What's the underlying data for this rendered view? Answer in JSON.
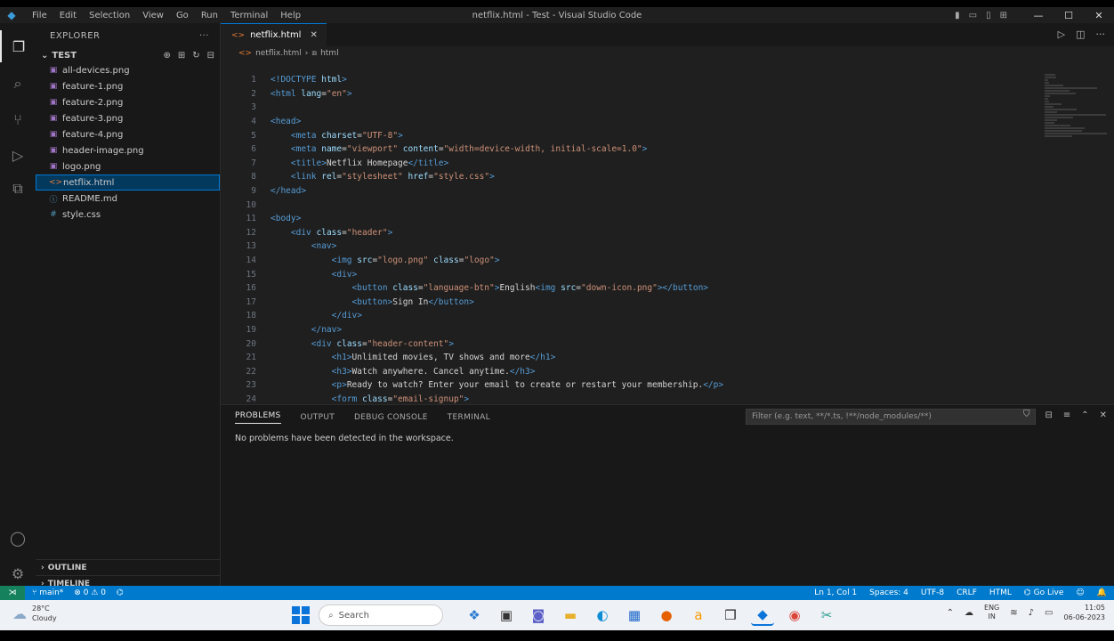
{
  "window": {
    "title": "netflix.html - Test - Visual Studio Code",
    "menu": [
      "File",
      "Edit",
      "Selection",
      "View",
      "Go",
      "Run",
      "Terminal",
      "Help"
    ]
  },
  "sidebar": {
    "header": "EXPLORER",
    "folder": "TEST",
    "files": [
      {
        "name": "all-devices.png",
        "icon": "image-icon"
      },
      {
        "name": "feature-1.png",
        "icon": "image-icon"
      },
      {
        "name": "feature-2.png",
        "icon": "image-icon"
      },
      {
        "name": "feature-3.png",
        "icon": "image-icon"
      },
      {
        "name": "feature-4.png",
        "icon": "image-icon"
      },
      {
        "name": "header-image.png",
        "icon": "image-icon"
      },
      {
        "name": "logo.png",
        "icon": "image-icon"
      },
      {
        "name": "netflix.html",
        "icon": "html-icon",
        "selected": true
      },
      {
        "name": "README.md",
        "icon": "markdown-icon"
      },
      {
        "name": "style.css",
        "icon": "css-icon"
      }
    ],
    "outline": "OUTLINE",
    "timeline": "TIMELINE"
  },
  "editor": {
    "tab": "netflix.html",
    "breadcrumb": [
      "netflix.html",
      "html"
    ],
    "lines": [
      [
        {
          "c": "t",
          "v": "<!"
        },
        {
          "c": "t",
          "v": "DOCTYPE"
        },
        {
          "c": "x",
          "v": " "
        },
        {
          "c": "a",
          "v": "html"
        },
        {
          "c": "t",
          "v": ">"
        }
      ],
      [
        {
          "c": "t",
          "v": "<html"
        },
        {
          "c": "x",
          "v": " "
        },
        {
          "c": "a",
          "v": "lang"
        },
        {
          "c": "x",
          "v": "="
        },
        {
          "c": "s",
          "v": "\"en\""
        },
        {
          "c": "t",
          "v": ">"
        }
      ],
      [],
      [
        {
          "c": "t",
          "v": "<head>"
        }
      ],
      [
        {
          "c": "x",
          "v": "    "
        },
        {
          "c": "t",
          "v": "<meta"
        },
        {
          "c": "x",
          "v": " "
        },
        {
          "c": "a",
          "v": "charset"
        },
        {
          "c": "x",
          "v": "="
        },
        {
          "c": "s",
          "v": "\"UTF-8\""
        },
        {
          "c": "t",
          "v": ">"
        }
      ],
      [
        {
          "c": "x",
          "v": "    "
        },
        {
          "c": "t",
          "v": "<meta"
        },
        {
          "c": "x",
          "v": " "
        },
        {
          "c": "a",
          "v": "name"
        },
        {
          "c": "x",
          "v": "="
        },
        {
          "c": "s",
          "v": "\"viewport\""
        },
        {
          "c": "x",
          "v": " "
        },
        {
          "c": "a",
          "v": "content"
        },
        {
          "c": "x",
          "v": "="
        },
        {
          "c": "s",
          "v": "\"width=device-width, initial-scale=1.0\""
        },
        {
          "c": "t",
          "v": ">"
        }
      ],
      [
        {
          "c": "x",
          "v": "    "
        },
        {
          "c": "t",
          "v": "<title>"
        },
        {
          "c": "x",
          "v": "Netflix Homepage"
        },
        {
          "c": "t",
          "v": "</title>"
        }
      ],
      [
        {
          "c": "x",
          "v": "    "
        },
        {
          "c": "t",
          "v": "<link"
        },
        {
          "c": "x",
          "v": " "
        },
        {
          "c": "a",
          "v": "rel"
        },
        {
          "c": "x",
          "v": "="
        },
        {
          "c": "s",
          "v": "\"stylesheet\""
        },
        {
          "c": "x",
          "v": " "
        },
        {
          "c": "a",
          "v": "href"
        },
        {
          "c": "x",
          "v": "="
        },
        {
          "c": "s",
          "v": "\"style.css\""
        },
        {
          "c": "t",
          "v": ">"
        }
      ],
      [
        {
          "c": "t",
          "v": "</head>"
        }
      ],
      [],
      [
        {
          "c": "t",
          "v": "<body>"
        }
      ],
      [
        {
          "c": "x",
          "v": "    "
        },
        {
          "c": "t",
          "v": "<div"
        },
        {
          "c": "x",
          "v": " "
        },
        {
          "c": "a",
          "v": "class"
        },
        {
          "c": "x",
          "v": "="
        },
        {
          "c": "s",
          "v": "\"header\""
        },
        {
          "c": "t",
          "v": ">"
        }
      ],
      [
        {
          "c": "x",
          "v": "        "
        },
        {
          "c": "t",
          "v": "<nav>"
        }
      ],
      [
        {
          "c": "x",
          "v": "            "
        },
        {
          "c": "t",
          "v": "<img"
        },
        {
          "c": "x",
          "v": " "
        },
        {
          "c": "a",
          "v": "src"
        },
        {
          "c": "x",
          "v": "="
        },
        {
          "c": "s",
          "v": "\"logo.png\""
        },
        {
          "c": "x",
          "v": " "
        },
        {
          "c": "a",
          "v": "class"
        },
        {
          "c": "x",
          "v": "="
        },
        {
          "c": "s",
          "v": "\"logo\""
        },
        {
          "c": "t",
          "v": ">"
        }
      ],
      [
        {
          "c": "x",
          "v": "            "
        },
        {
          "c": "t",
          "v": "<div>"
        }
      ],
      [
        {
          "c": "x",
          "v": "                "
        },
        {
          "c": "t",
          "v": "<button"
        },
        {
          "c": "x",
          "v": " "
        },
        {
          "c": "a",
          "v": "class"
        },
        {
          "c": "x",
          "v": "="
        },
        {
          "c": "s",
          "v": "\"language-btn\""
        },
        {
          "c": "t",
          "v": ">"
        },
        {
          "c": "x",
          "v": "English"
        },
        {
          "c": "t",
          "v": "<img"
        },
        {
          "c": "x",
          "v": " "
        },
        {
          "c": "a",
          "v": "src"
        },
        {
          "c": "x",
          "v": "="
        },
        {
          "c": "s",
          "v": "\"down-icon.png\""
        },
        {
          "c": "t",
          "v": "></button>"
        }
      ],
      [
        {
          "c": "x",
          "v": "                "
        },
        {
          "c": "t",
          "v": "<button>"
        },
        {
          "c": "x",
          "v": "Sign In"
        },
        {
          "c": "t",
          "v": "</button>"
        }
      ],
      [
        {
          "c": "x",
          "v": "            "
        },
        {
          "c": "t",
          "v": "</div>"
        }
      ],
      [
        {
          "c": "x",
          "v": "        "
        },
        {
          "c": "t",
          "v": "</nav>"
        }
      ],
      [
        {
          "c": "x",
          "v": "        "
        },
        {
          "c": "t",
          "v": "<div"
        },
        {
          "c": "x",
          "v": " "
        },
        {
          "c": "a",
          "v": "class"
        },
        {
          "c": "x",
          "v": "="
        },
        {
          "c": "s",
          "v": "\"header-content\""
        },
        {
          "c": "t",
          "v": ">"
        }
      ],
      [
        {
          "c": "x",
          "v": "            "
        },
        {
          "c": "t",
          "v": "<h1>"
        },
        {
          "c": "x",
          "v": "Unlimited movies, TV shows and more"
        },
        {
          "c": "t",
          "v": "</h1>"
        }
      ],
      [
        {
          "c": "x",
          "v": "            "
        },
        {
          "c": "t",
          "v": "<h3>"
        },
        {
          "c": "x",
          "v": "Watch anywhere. Cancel anytime."
        },
        {
          "c": "t",
          "v": "</h3>"
        }
      ],
      [
        {
          "c": "x",
          "v": "            "
        },
        {
          "c": "t",
          "v": "<p>"
        },
        {
          "c": "x",
          "v": "Ready to watch? Enter your email to create or restart your membership."
        },
        {
          "c": "t",
          "v": "</p>"
        }
      ],
      [
        {
          "c": "x",
          "v": "            "
        },
        {
          "c": "t",
          "v": "<form"
        },
        {
          "c": "x",
          "v": " "
        },
        {
          "c": "a",
          "v": "class"
        },
        {
          "c": "x",
          "v": "="
        },
        {
          "c": "s",
          "v": "\"email-signup\""
        },
        {
          "c": "t",
          "v": ">"
        }
      ]
    ]
  },
  "panel": {
    "tabs": [
      "PROBLEMS",
      "OUTPUT",
      "DEBUG CONSOLE",
      "TERMINAL"
    ],
    "active_tab": "PROBLEMS",
    "filter_placeholder": "Filter (e.g. text, **/*.ts, !**/node_modules/**)",
    "message": "No problems have been detected in the workspace."
  },
  "statusbar": {
    "branch": "main*",
    "errors": "0",
    "warnings": "0",
    "position": "Ln 1, Col 1",
    "spaces": "Spaces: 4",
    "encoding": "UTF-8",
    "eol": "CRLF",
    "language": "HTML",
    "golive": "Go Live"
  },
  "taskbar": {
    "weather_temp": "28°C",
    "weather_desc": "Cloudy",
    "search": "Search",
    "lang_top": "ENG",
    "lang_bottom": "IN",
    "time": "11:05",
    "date": "06-06-2023"
  },
  "colors": {
    "accent": "#007acc",
    "selection": "#04395e"
  }
}
